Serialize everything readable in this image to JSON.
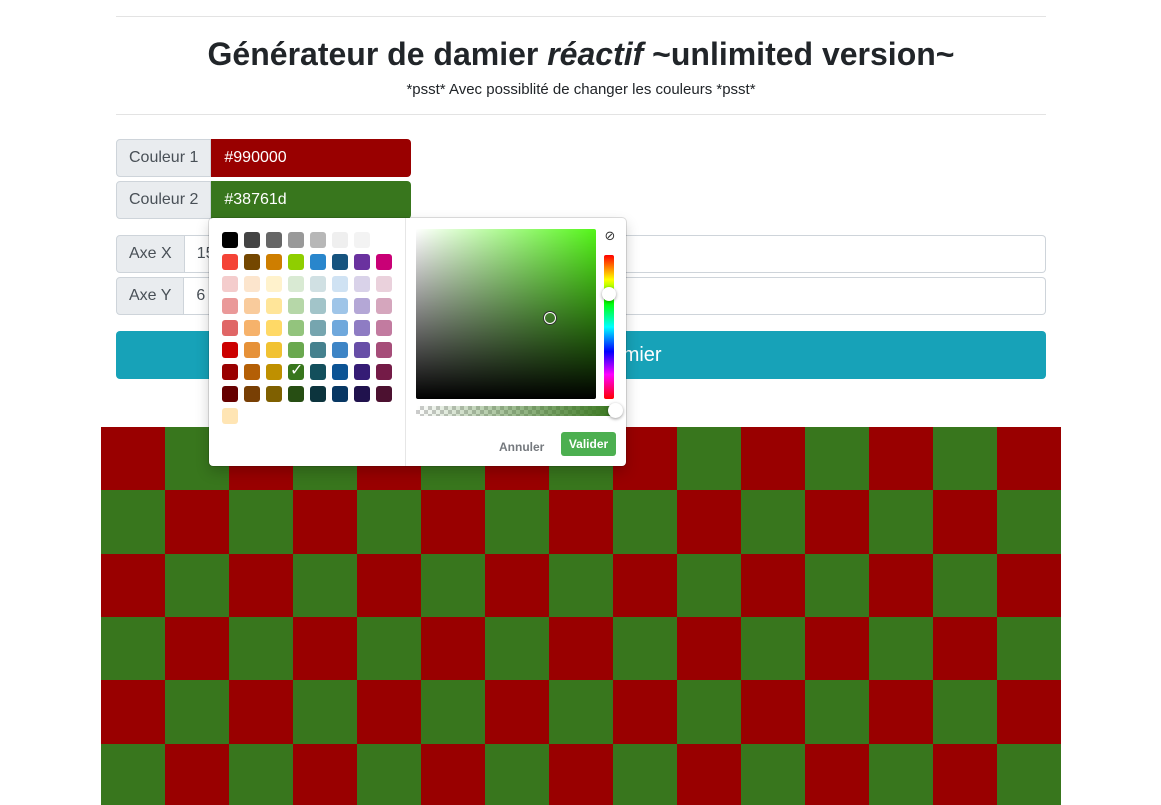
{
  "header": {
    "title_main": "Générateur de damier ",
    "title_emph": "réactif",
    "title_tail": " ~unlimited version~",
    "subtitle": "*psst* Avec possiblité de changer les couleurs *psst*"
  },
  "form": {
    "color1": {
      "label": "Couleur 1",
      "value": "#990000"
    },
    "color2": {
      "label": "Couleur 2",
      "value": "#38761d"
    },
    "axis_x": {
      "label": "Axe X",
      "value": "15"
    },
    "axis_y": {
      "label": "Axe Y",
      "value": "6"
    },
    "generate_button": "Générer le damier"
  },
  "picker": {
    "cancel_label": "Annuler",
    "validate_label": "Valider",
    "selected_color": "#38761d",
    "palette": [
      [
        "#000000",
        "#434343",
        "#666666",
        "#999999",
        "#b7b7b7",
        "#efefef",
        "#f3f3f3",
        "#ffffff"
      ],
      [
        "#f44336",
        "#744700",
        "#ce7e00",
        "#8fce00",
        "#2986cc",
        "#16537e",
        "#6a329f",
        "#c90076"
      ],
      [
        "#f4cccc",
        "#fce5cd",
        "#fff2cc",
        "#d9ead3",
        "#d0e0e3",
        "#cfe2f3",
        "#d9d2e9",
        "#ead1dc"
      ],
      [
        "#ea9999",
        "#f9cb9c",
        "#ffe599",
        "#b6d7a8",
        "#a2c4c9",
        "#9fc5e8",
        "#b4a7d6",
        "#d5a6bd"
      ],
      [
        "#e06666",
        "#f6b26b",
        "#ffd966",
        "#93c47d",
        "#76a5af",
        "#6fa8dc",
        "#8e7cc3",
        "#c27ba0"
      ],
      [
        "#cc0000",
        "#e69138",
        "#f1c232",
        "#6aa84f",
        "#45818e",
        "#3d85c6",
        "#674ea7",
        "#a64d79"
      ],
      [
        "#990000",
        "#b45f06",
        "#bf9000",
        "#38761d",
        "#134f5c",
        "#0b5394",
        "#351c75",
        "#741b47"
      ],
      [
        "#660000",
        "#783f04",
        "#7f6000",
        "#274e13",
        "#0c343d",
        "#073763",
        "#20124d",
        "#4c1130"
      ],
      [
        "#ffe5b4"
      ]
    ]
  },
  "board": {
    "cols": 15,
    "rows": 6,
    "color1": "#990000",
    "color2": "#38761d"
  }
}
